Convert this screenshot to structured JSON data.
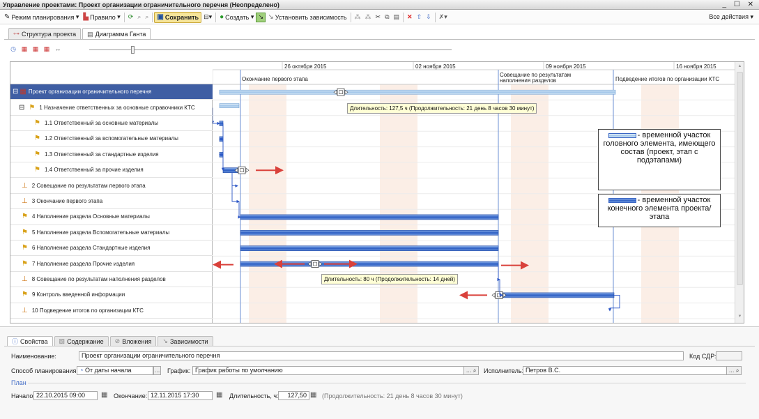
{
  "window": {
    "title": "Управление проектами: Проект организации ограничительного перечня (Неопределено)",
    "controls": "_ ☐ ✕"
  },
  "toolbar": {
    "planning_mode": "Режим планирования",
    "rule": "Правило",
    "save": "Сохранить",
    "create": "Создать",
    "set_dependency": "Установить зависимость",
    "all_actions": "Все действия"
  },
  "tabs": [
    {
      "label": "Структура проекта"
    },
    {
      "label": "Диаграмма Ганта"
    }
  ],
  "timeline": {
    "dates": [
      "26 октября 2015",
      "02 ноября 2015",
      "09 ноября 2015",
      "16 ноября 2015"
    ],
    "milestones": [
      "Окончание первого этапа",
      "Совещание по результатам наполнения разделов",
      "Подведение итогов по организации КТС"
    ]
  },
  "rows": [
    {
      "label": "Проект организации ограничительного перечня",
      "indent": 0,
      "kind": "project",
      "expand": "⊟"
    },
    {
      "label": "1 Назначение ответственных за основные справочники КТС",
      "indent": 1,
      "kind": "group",
      "expand": "⊟"
    },
    {
      "label": "1.1 Ответственный за основные материалы",
      "indent": 2,
      "kind": "task"
    },
    {
      "label": "1.2 Ответственный за вспомогательные материалы",
      "indent": 2,
      "kind": "task"
    },
    {
      "label": "1.3 Ответственный за стандартные изделия",
      "indent": 2,
      "kind": "task"
    },
    {
      "label": "1.4 Ответственный за прочие изделия",
      "indent": 2,
      "kind": "task"
    },
    {
      "label": "2 Совещание по результатам первого этапа",
      "indent": 1,
      "kind": "milestone"
    },
    {
      "label": "3 Окончание первого этапа",
      "indent": 1,
      "kind": "milestone"
    },
    {
      "label": "4 Наполнение раздела Основные материалы",
      "indent": 1,
      "kind": "task"
    },
    {
      "label": "5 Наполнение раздела Вспомогательные материалы",
      "indent": 1,
      "kind": "task"
    },
    {
      "label": "6 Наполнение раздела Стандартные изделия",
      "indent": 1,
      "kind": "task"
    },
    {
      "label": "7 Наполнение раздела Прочие изделия",
      "indent": 1,
      "kind": "task"
    },
    {
      "label": "8 Совещание по результатам наполнения разделов",
      "indent": 1,
      "kind": "milestone"
    },
    {
      "label": "9 Контроль введенной информации",
      "indent": 1,
      "kind": "task"
    },
    {
      "label": "10 Подведение итогов по организации КТС",
      "indent": 1,
      "kind": "milestone"
    }
  ],
  "tooltips": {
    "project": "Длительность: 127,5 ч (Продолжительность: 21 день 8 часов 30 минут)",
    "task7": "Длительность: 80 ч (Продолжительность: 14 дней)"
  },
  "legend": {
    "head": "- временной участок головного элемента, имеющего состав (проект, этап с подэтапами)",
    "leaf": "- временной участок конечного элемента проекта/этапа"
  },
  "props": {
    "tabs": [
      "Свойства",
      "Содержание",
      "Вложения",
      "Зависимости"
    ],
    "name_label": "Наименование:",
    "name_value": "Проект организации ограничительного перечня",
    "code_label": "Код СДР:",
    "code_value": "",
    "method_label": "Способ планирования:",
    "method_value": "От даты начала",
    "schedule_label": "График:",
    "schedule_value": "График работы по умолчанию",
    "executor_label": "Исполнитель:",
    "executor_value": "Петров В.С.",
    "plan_label": "План",
    "start_label": "Начало:",
    "start_value": "22.10.2015 09:00",
    "end_label": "Окончание:",
    "end_value": "12.11.2015 17:30",
    "duration_label": "Длительность, ч:",
    "duration_value": "127,50",
    "duration_note": "(Продолжительность: 21 день 8 часов 30 минут)"
  }
}
